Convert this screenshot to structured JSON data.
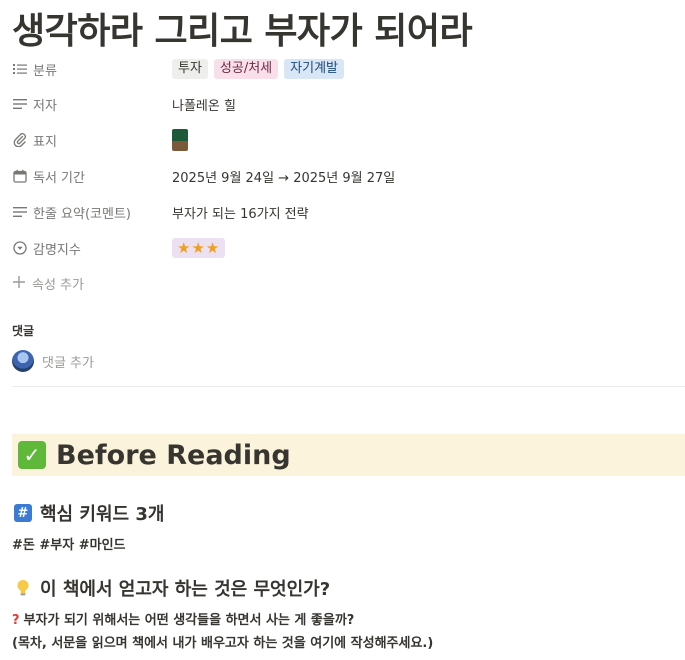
{
  "page": {
    "title": "생각하라 그리고 부자가 되어라"
  },
  "properties": {
    "category": {
      "label": "분류",
      "icon": "list-icon",
      "tags": [
        {
          "text": "투자",
          "bg": "#eeeeec",
          "fg": "#37352f"
        },
        {
          "text": "성공/처세",
          "bg": "#f9dfe9",
          "fg": "#6b2c45"
        },
        {
          "text": "자기계발",
          "bg": "#d8e6f5",
          "fg": "#1f4a75"
        }
      ]
    },
    "author": {
      "label": "저자",
      "icon": "text-lines-icon",
      "value": "나폴레온 힐"
    },
    "cover": {
      "label": "표지",
      "icon": "paperclip-icon"
    },
    "reading_period": {
      "label": "독서 기간",
      "icon": "calendar-icon",
      "value": "2025년 9월 24일 → 2025년 9월 27일"
    },
    "summary": {
      "label": "한줄 요약(코멘트)",
      "icon": "text-lines-icon",
      "value": "부자가 되는 16가지 전략"
    },
    "rating": {
      "label": "감명지수",
      "icon": "select-circle-icon",
      "value": "★★★",
      "stars": 3
    }
  },
  "add_property": {
    "label": "속성 추가",
    "icon": "plus-icon"
  },
  "comments": {
    "label": "댓글",
    "add_label": "댓글 추가"
  },
  "callout": {
    "icon": "check-mark-icon",
    "title": "Before Reading",
    "bg": "#fbf3db",
    "check_color": "#5fb83a"
  },
  "section_keywords": {
    "icon": "hash-icon",
    "title": "핵심 키워드 3개",
    "body": "#돈 #부자 #마인드"
  },
  "section_goal": {
    "icon": "lightbulb-icon",
    "title": "이 책에서 얻고자 하는 것은 무엇인가?",
    "question": "부자가 되기 위해서는 어떤 생각들을 하면서 사는 게 좋을까?",
    "note": "(목차, 서문을 읽으며 책에서 내가 배우고자 하는 것을 여기에 작성해주세요.)"
  }
}
